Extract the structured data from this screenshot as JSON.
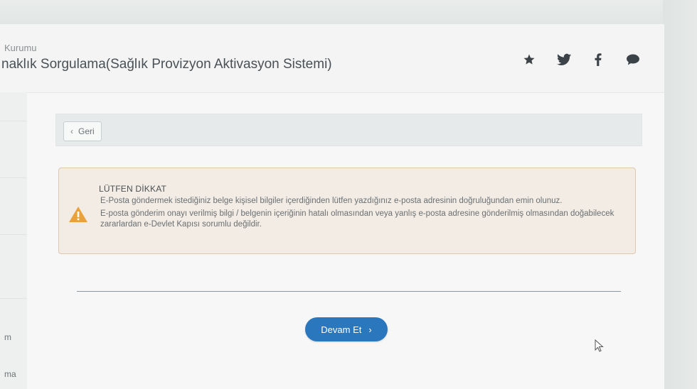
{
  "header": {
    "org": "Kurumu",
    "title": "naklık Sorgulama(Sağlık Provizyon Aktivasyon Sistemi)",
    "social_icons": [
      "star-icon",
      "twitter-icon",
      "facebook-icon",
      "comment-icon"
    ]
  },
  "sidebar": {
    "items": [
      "m",
      "ma"
    ]
  },
  "nav": {
    "back_label": "Geri"
  },
  "alert": {
    "title": "LÜTFEN DİKKAT",
    "message_1": "E-Posta göndermek istediğiniz belge kişisel bilgiler içerdiğinden lütfen yazdığınız e-posta adresinin doğruluğundan emin olunuz.",
    "message_2": "E-posta gönderim onayı verilmiş bilgi / belgenin içeriğinin hatalı olmasından veya yanlış e-posta adresine gönderilmiş olmasından doğabilecek zararlardan e-Devlet Kapısı sorumlu değildir.",
    "icon": "warning-icon",
    "icon_color": "#e9a23b"
  },
  "actions": {
    "continue_label": "Devam Et",
    "continue_color": "#2a77bd"
  }
}
